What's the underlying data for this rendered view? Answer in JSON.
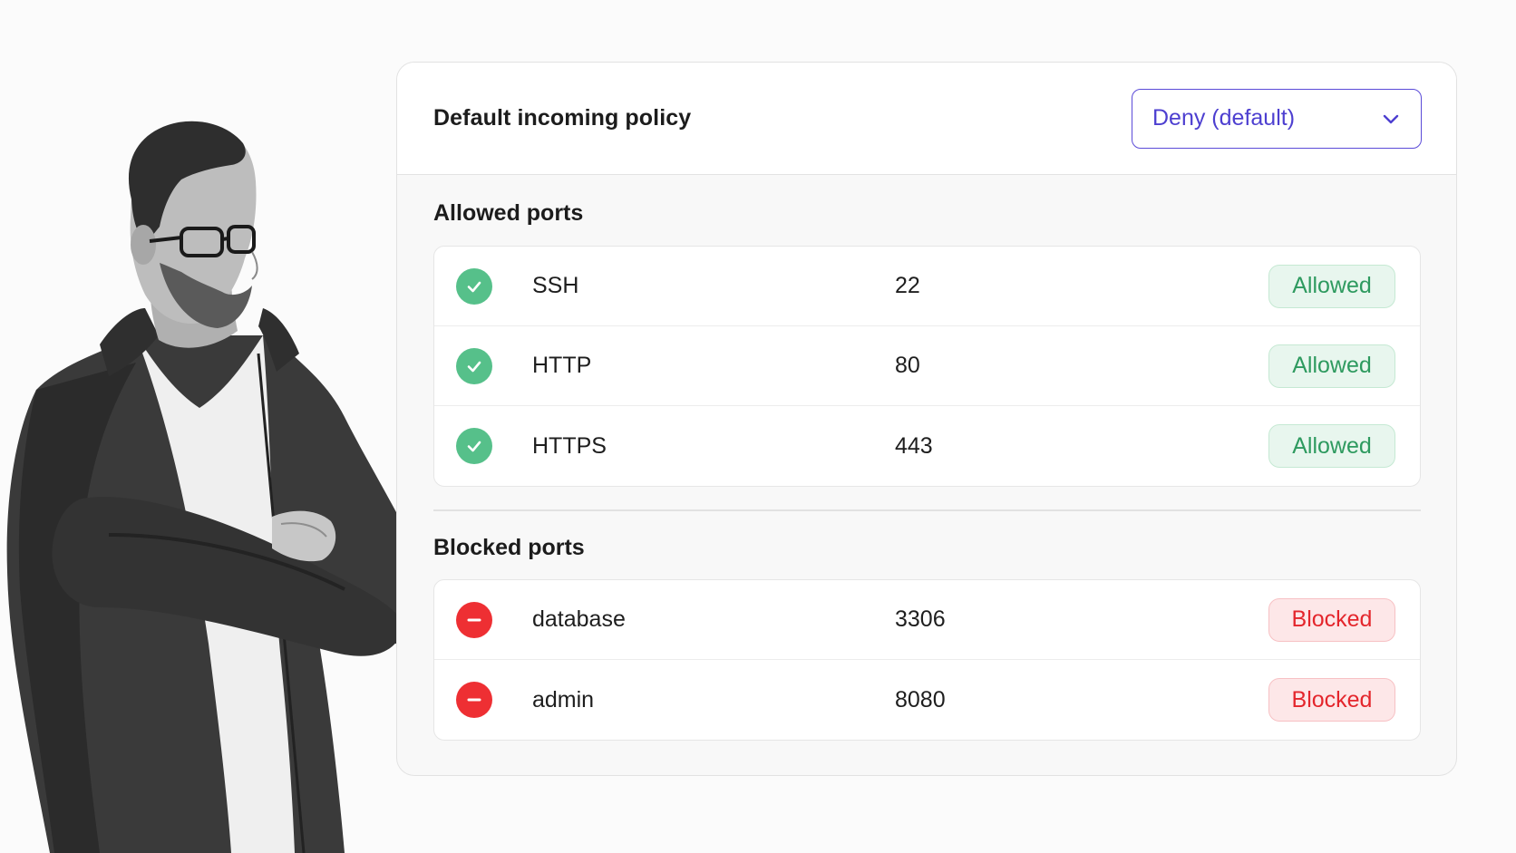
{
  "policy": {
    "label": "Default incoming policy",
    "selected": "Deny (default)"
  },
  "allowed": {
    "title": "Allowed ports",
    "rows": [
      {
        "name": "SSH",
        "port": "22",
        "status": "Allowed",
        "icon": "check-circle-icon"
      },
      {
        "name": "HTTP",
        "port": "80",
        "status": "Allowed",
        "icon": "check-circle-icon"
      },
      {
        "name": "HTTPS",
        "port": "443",
        "status": "Allowed",
        "icon": "check-circle-icon"
      }
    ]
  },
  "blocked": {
    "title": "Blocked ports",
    "rows": [
      {
        "name": "database",
        "port": "3306",
        "status": "Blocked",
        "icon": "minus-circle-icon"
      },
      {
        "name": "admin",
        "port": "8080",
        "status": "Blocked",
        "icon": "minus-circle-icon"
      }
    ]
  },
  "colors": {
    "accent": "#4d3fd0",
    "allowed": "#56c08a",
    "blocked": "#ee2f33"
  }
}
